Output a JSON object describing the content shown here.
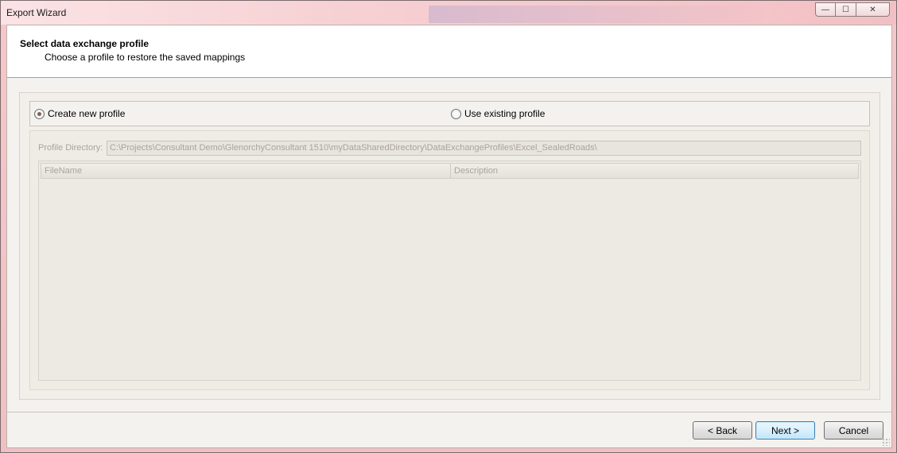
{
  "window": {
    "title": "Export Wizard",
    "caption_buttons": {
      "minimize": "—",
      "maximize": "☐",
      "close": "✕"
    }
  },
  "header": {
    "title": "Select data exchange profile",
    "subtitle": "Choose a profile to restore the saved mappings"
  },
  "profile_mode": {
    "options": [
      {
        "label": "Create new profile",
        "selected": true
      },
      {
        "label": "Use existing profile",
        "selected": false
      }
    ]
  },
  "profile_directory": {
    "label": "Profile Directory:",
    "value": "C:\\Projects\\Consultant Demo\\GlenorchyConsultant 1510\\myDataSharedDirectory\\DataExchangeProfiles\\Excel_SealedRoads\\",
    "enabled": false
  },
  "profile_grid": {
    "columns": [
      "FileName",
      "Description"
    ],
    "rows": []
  },
  "buttons": {
    "back": "< Back",
    "next": "Next >",
    "cancel": "Cancel"
  }
}
